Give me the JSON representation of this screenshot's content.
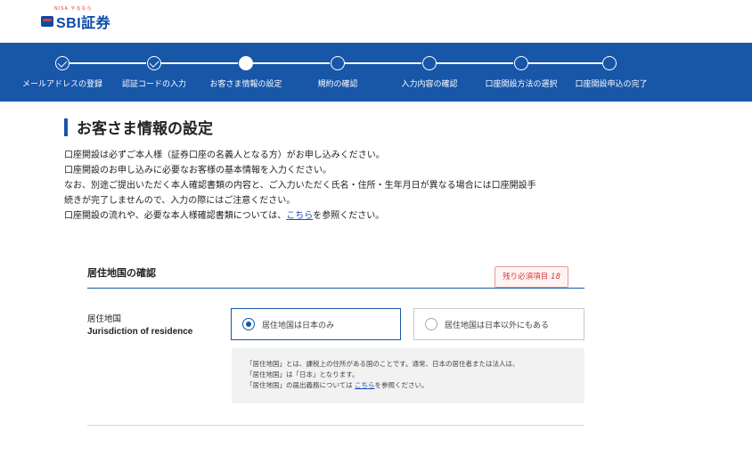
{
  "header": {
    "logo_text": "SBI証券",
    "logo_sub": "NISA やるなら"
  },
  "steps": [
    {
      "label": "メールアドレスの登録",
      "state": "done"
    },
    {
      "label": "認証コードの入力",
      "state": "done"
    },
    {
      "label": "お客さま情報の設定",
      "state": "current"
    },
    {
      "label": "規約の確認",
      "state": "todo"
    },
    {
      "label": "入力内容の確認",
      "state": "todo"
    },
    {
      "label": "口座開設方法の選択",
      "state": "todo"
    },
    {
      "label": "口座開設申込の完了",
      "state": "todo"
    }
  ],
  "page": {
    "title": "お客さま情報の設定",
    "intro": {
      "line1": "口座開設は必ずご本人様（証券口座の名義人となる方）がお申し込みください。",
      "line2": "口座開設のお申し込みに必要なお客様の基本情報を入力ください。",
      "line3": "なお、別途ご提出いただく本人確認書類の内容と、ご入力いただく氏名・住所・生年月日が異なる場合には口座開設手",
      "line4": "続きが完了しませんので、入力の際にはご注意ください。",
      "line5_pre": "口座開設の流れや、必要な本人様確認書類については、",
      "line5_link": "こちら",
      "line5_post": "を参照ください。"
    }
  },
  "section": {
    "title": "居住地国の確認",
    "required_label": "残り必須項目",
    "required_count": "18"
  },
  "residence": {
    "label_ja": "居住地国",
    "label_en": "Jurisdiction of residence",
    "options": [
      {
        "label": "居住地国は日本のみ",
        "selected": true
      },
      {
        "label": "居住地国は日本以外にもある",
        "selected": false
      }
    ],
    "note": {
      "line1": "「居住地国」とは、課税上の住所がある国のことです。通常、日本の居住者または法人は、",
      "line2": "「居住地国」は「日本」となります。",
      "line3_pre": "「居住地国」の届出義務については ",
      "line3_link": "こちら",
      "line3_post": "を参照ください。"
    }
  },
  "colors": {
    "brand_blue": "#1856a8",
    "required_red": "#d83a3a"
  }
}
